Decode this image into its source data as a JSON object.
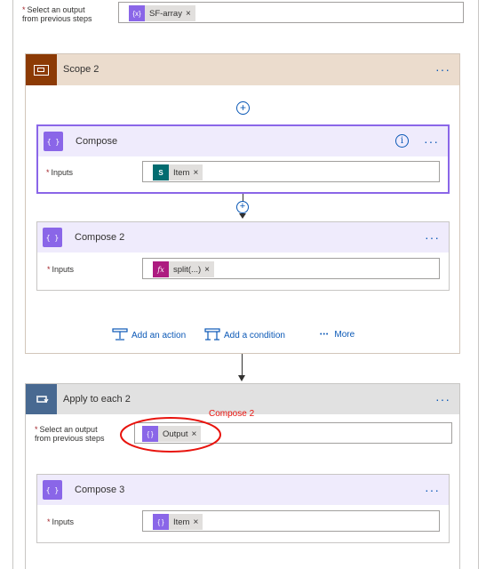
{
  "top": {
    "label_line1": "Select an output",
    "label_line2": "from previous steps",
    "token_label": "SF-array",
    "token_icon": "{x}"
  },
  "scope": {
    "title": "Scope 2",
    "color": "#8c3a05",
    "header_bg": "#ebdccd"
  },
  "compose1": {
    "title": "Compose",
    "inputs_label": "Inputs",
    "token_label": "Item",
    "token_icon": "S"
  },
  "compose2": {
    "title": "Compose 2",
    "inputs_label": "Inputs",
    "token_label": "split(...)",
    "token_icon": "fx"
  },
  "actions": {
    "add_action": "Add an action",
    "add_condition": "Add a condition",
    "more": "More",
    "more_dots": "•••"
  },
  "apply": {
    "title": "Apply to each 2",
    "label_line1": "Select an output",
    "label_line2": "from previous steps",
    "token_label": "Output",
    "annotation": "Compose 2",
    "annotation_color": "#e8140e"
  },
  "compose3": {
    "title": "Compose 3",
    "inputs_label": "Inputs",
    "token_label": "Item"
  },
  "icons": {
    "remove": "×",
    "menu": "···",
    "info": "i",
    "plus": "+",
    "req": "*"
  }
}
